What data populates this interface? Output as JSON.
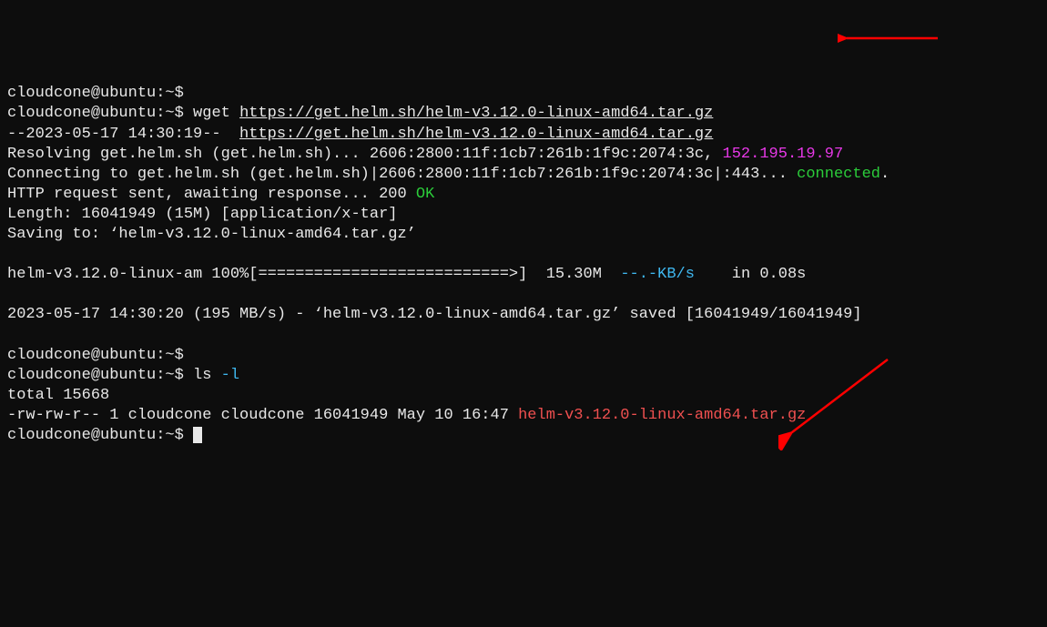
{
  "prompt": "cloudcone@ubuntu:~$",
  "cmd_wget": "wget",
  "url": "https://get.helm.sh/helm-v3.12.0-linux-amd64.tar.gz",
  "ts_start_prefix": "--2023-05-17 14:30:19--  ",
  "resolve_prefix": "Resolving get.helm.sh (get.helm.sh)... 2606:2800:11f:1cb7:261b:1f9c:2074:3c, ",
  "ip": "152.195.19.97",
  "connecting_prefix": "Connecting to get.helm.sh (get.helm.sh)|2606:2800:11f:1cb7:261b:1f9c:2074:3c|:443... ",
  "connected": "connected",
  "dot": ".",
  "http_req": "HTTP request sent, awaiting response... 200 ",
  "ok": "OK",
  "length": "Length: 16041949 (15M) [application/x-tar]",
  "saving": "Saving to: ‘helm-v3.12.0-linux-amd64.tar.gz’",
  "progress_name": "helm-v3.12.0-linux-am 100%[===========================>]  15.30M  ",
  "progress_speed": "--.-KB/s",
  "progress_time": "    in 0.08s",
  "saved": "2023-05-17 14:30:20 (195 MB/s) - ‘helm-v3.12.0-linux-amd64.tar.gz’ saved [16041949/16041949]",
  "cmd_ls": "ls ",
  "ls_flag": "-l",
  "total": "total 15668",
  "perms": "-rw-rw-r-- 1 cloudcone cloudcone 16041949 May 10 16:47 ",
  "filename": "helm-v3.12.0-linux-amd64.tar.gz"
}
